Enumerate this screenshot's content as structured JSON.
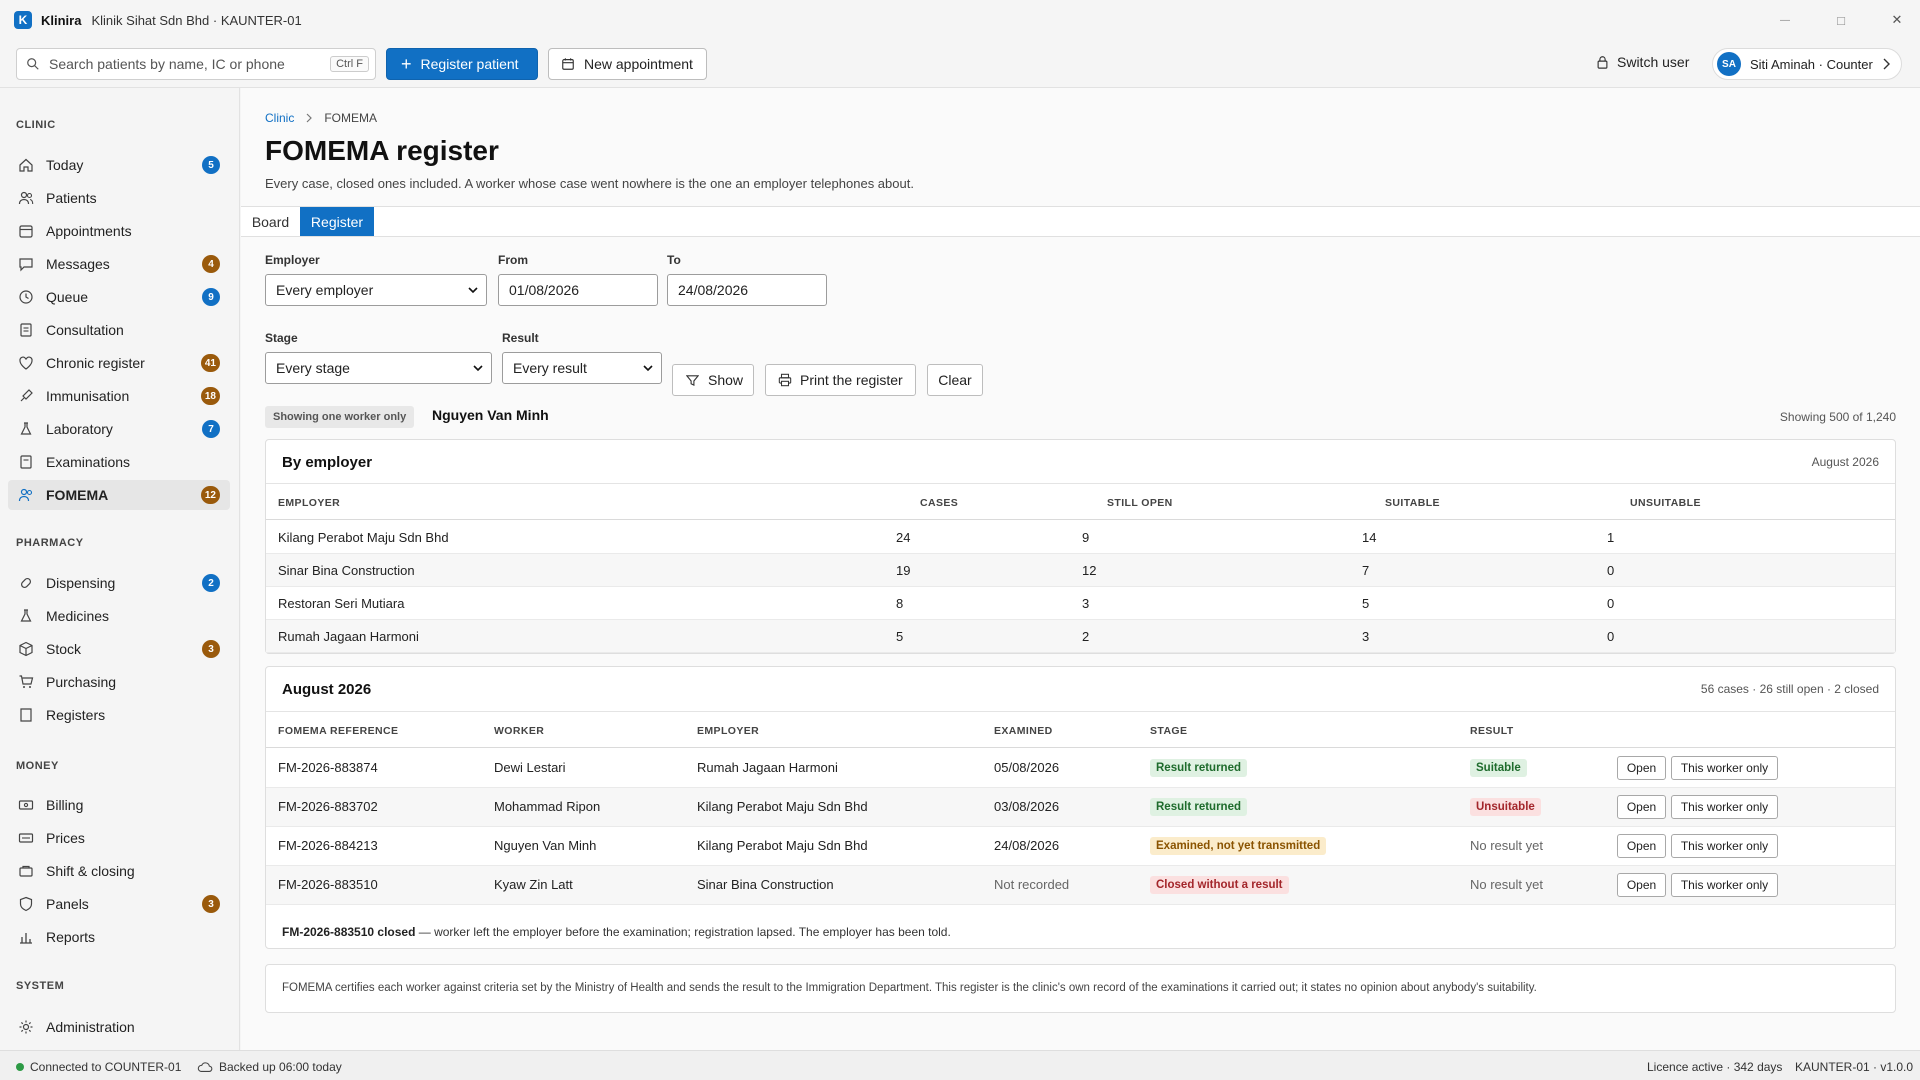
{
  "app": {
    "logo_letter": "K",
    "name": "Klinira",
    "window_title": "Klinik Sihat Sdn Bhd · KAUNTER-01"
  },
  "window_controls": {
    "minimize": "—",
    "maximize": "□",
    "close": "✕"
  },
  "toolbar": {
    "search_placeholder": "Search patients by name, IC or phone",
    "search_shortcut": "Ctrl F",
    "register_patient": "Register patient",
    "new_appointment": "New appointment",
    "switch_user": "Switch user",
    "user_initials": "SA",
    "user_label": "Siti Aminah · Counter"
  },
  "sidebar": {
    "sections": {
      "clinic": "CLINIC",
      "pharmacy": "PHARMACY",
      "money": "MONEY",
      "system": "SYSTEM"
    },
    "clinic": [
      {
        "label": "Today",
        "badge": "5",
        "badge_color": "#1170c4"
      },
      {
        "label": "Patients",
        "badge": ""
      },
      {
        "label": "Appointments",
        "badge": ""
      },
      {
        "label": "Messages",
        "badge": "4",
        "badge_color": "#9a5a0c"
      },
      {
        "label": "Queue",
        "badge": "9",
        "badge_color": "#1170c4"
      },
      {
        "label": "Consultation",
        "badge": ""
      },
      {
        "label": "Chronic register",
        "badge": "41",
        "badge_color": "#9a5a0c"
      },
      {
        "label": "Immunisation",
        "badge": "18",
        "badge_color": "#9a5a0c"
      },
      {
        "label": "Laboratory",
        "badge": "7",
        "badge_color": "#1170c4"
      },
      {
        "label": "Examinations",
        "badge": ""
      },
      {
        "label": "FOMEMA",
        "badge": "12",
        "badge_color": "#9a5a0c",
        "active": true
      }
    ],
    "pharmacy": [
      {
        "label": "Dispensing",
        "badge": "2",
        "badge_color": "#1170c4"
      },
      {
        "label": "Medicines",
        "badge": ""
      },
      {
        "label": "Stock",
        "badge": "3",
        "badge_color": "#9a5a0c"
      },
      {
        "label": "Purchasing",
        "badge": ""
      },
      {
        "label": "Registers",
        "badge": ""
      }
    ],
    "money": [
      {
        "label": "Billing",
        "badge": ""
      },
      {
        "label": "Prices",
        "badge": ""
      },
      {
        "label": "Shift & closing",
        "badge": ""
      },
      {
        "label": "Panels",
        "badge": "3",
        "badge_color": "#9a5a0c"
      },
      {
        "label": "Reports",
        "badge": ""
      }
    ],
    "system": [
      {
        "label": "Administration",
        "badge": ""
      }
    ]
  },
  "page": {
    "breadcrumb_root": "Clinic",
    "breadcrumb_current": "FOMEMA",
    "title": "FOMEMA register",
    "subtitle": "Every case, closed ones included. A worker whose case went nowhere is the one an employer telephones about.",
    "tabs": [
      "Board",
      "Register"
    ],
    "active_tab": "Register"
  },
  "filters": {
    "employer_label": "Employer",
    "employer_value": "Every employer",
    "from_label": "From",
    "from_value": "01/08/2026",
    "to_label": "To",
    "to_value": "24/08/2026",
    "stage_label": "Stage",
    "stage_value": "Every stage",
    "result_label": "Result",
    "result_value": "Every result",
    "show": "Show",
    "print": "Print the register",
    "clear": "Clear"
  },
  "worker_filter": {
    "chip": "Showing one worker only",
    "worker": "Nguyen Van Minh",
    "showing": "Showing 500 of 1,240"
  },
  "by_employer": {
    "title": "By employer",
    "period": "August 2026",
    "columns": [
      "EMPLOYER",
      "CASES",
      "STILL OPEN",
      "SUITABLE",
      "UNSUITABLE"
    ],
    "rows": [
      [
        "Kilang Perabot Maju Sdn Bhd",
        "24",
        "9",
        "14",
        "1"
      ],
      [
        "Sinar Bina Construction",
        "19",
        "12",
        "7",
        "0"
      ],
      [
        "Restoran Seri Mutiara",
        "8",
        "3",
        "5",
        "0"
      ],
      [
        "Rumah Jagaan Harmoni",
        "5",
        "2",
        "3",
        "0"
      ]
    ]
  },
  "cases": {
    "title": "August 2026",
    "summary": "56 cases · 26 still open · 2 closed",
    "columns": [
      "FOMEMA REFERENCE",
      "WORKER",
      "EMPLOYER",
      "EXAMINED",
      "STAGE",
      "RESULT"
    ],
    "open_label": "Open",
    "worker_only_label": "This worker only",
    "rows": [
      {
        "ref": "FM-2026-883874",
        "worker": "Dewi Lestari",
        "employer": "Rumah Jagaan Harmoni",
        "examined": "05/08/2026",
        "stage": "Result returned",
        "stage_tone": "green",
        "result": "Suitable",
        "result_tone": "green"
      },
      {
        "ref": "FM-2026-883702",
        "worker": "Mohammad Ripon",
        "employer": "Kilang Perabot Maju Sdn Bhd",
        "examined": "03/08/2026",
        "stage": "Result returned",
        "stage_tone": "green",
        "result": "Unsuitable",
        "result_tone": "red"
      },
      {
        "ref": "FM-2026-884213",
        "worker": "Nguyen Van Minh",
        "employer": "Kilang Perabot Maju Sdn Bhd",
        "examined": "24/08/2026",
        "stage": "Examined, not yet transmitted",
        "stage_tone": "amber",
        "result": "No result yet",
        "result_tone": "none"
      },
      {
        "ref": "FM-2026-883510",
        "worker": "Kyaw Zin Latt",
        "employer": "Sinar Bina Construction",
        "examined": "Not recorded",
        "stage": "Closed without a result",
        "stage_tone": "red",
        "result": "No result yet",
        "result_tone": "none"
      }
    ],
    "closed_note_ref": "FM-2026-883510 closed",
    "closed_note_text": " — worker left the employer before the examination; registration lapsed. The employer has been told."
  },
  "disclaimer": "FOMEMA certifies each worker against criteria set by the Ministry of Health and sends the result to the Immigration Department. This register is the clinic's own record of the examinations it carried out; it states no opinion about anybody's suitability.",
  "statusbar": {
    "connected": "Connected to COUNTER-01",
    "backup": "Backed up 06:00 today",
    "licence": "Licence active · 342 days",
    "version": "KAUNTER-01 · v1.0.0"
  }
}
